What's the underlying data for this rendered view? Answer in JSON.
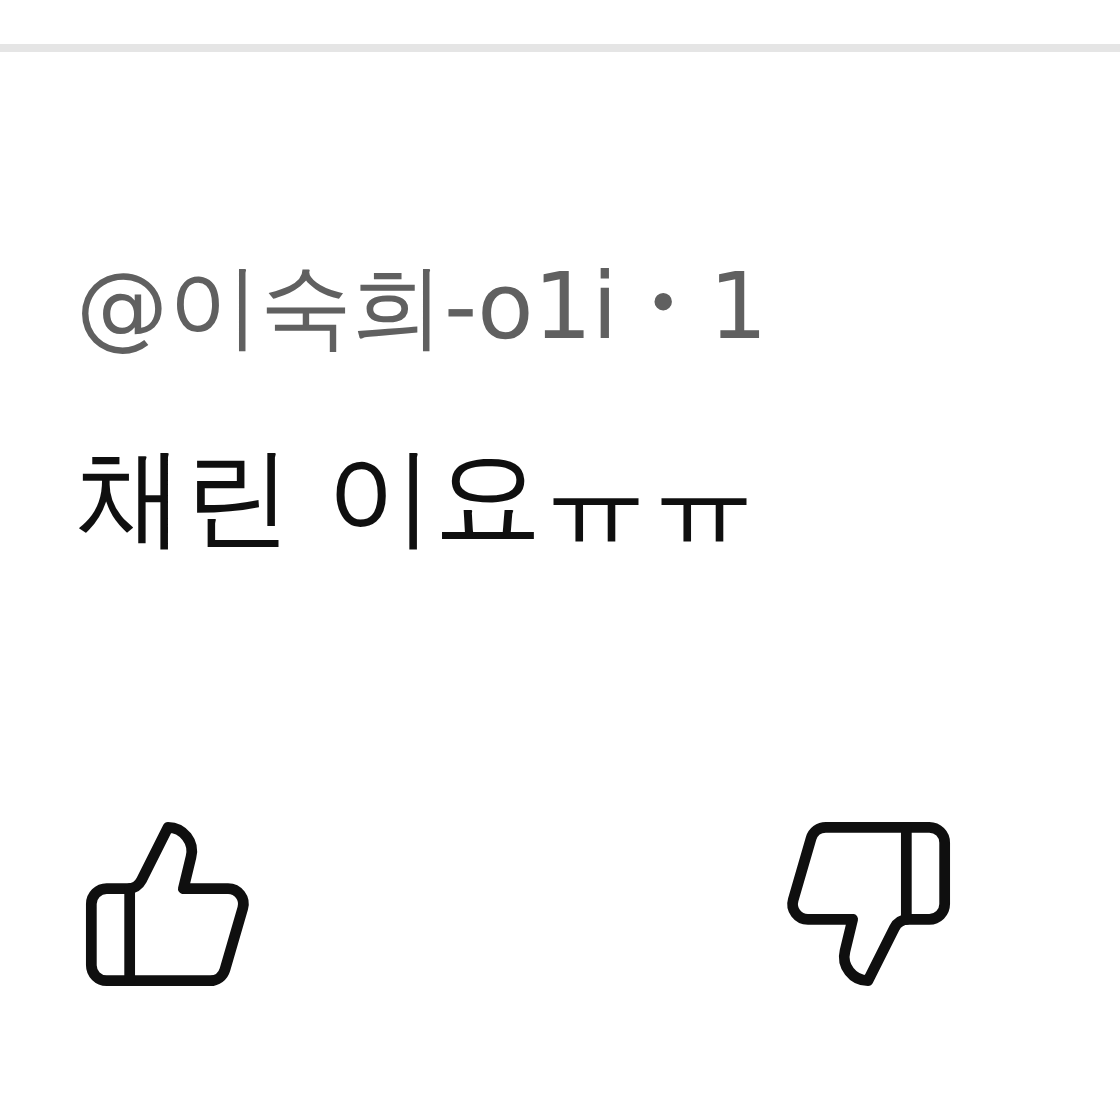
{
  "comment": {
    "author": "@이숙희-o1i",
    "separator": "•",
    "time": "1",
    "text": "채린 이요ㅠㅠ"
  }
}
